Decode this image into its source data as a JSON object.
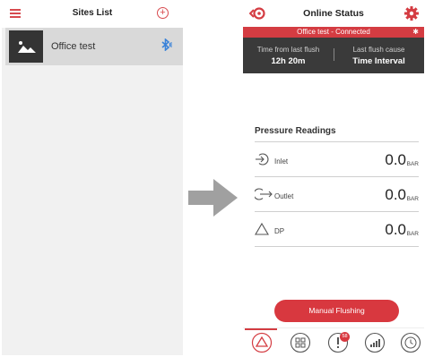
{
  "left": {
    "title": "Sites List",
    "add_symbol": "+",
    "site": {
      "name": "Office test",
      "bluetooth_symbol": "✱"
    }
  },
  "right": {
    "title": "Online Status",
    "status_text": "Office test - Connected",
    "status_bt": "✱",
    "flush_info": {
      "time_label": "Time from last flush",
      "time_value": "12h 20m",
      "cause_label": "Last flush cause",
      "cause_value": "Time Interval"
    },
    "pressure_title": "Pressure Readings",
    "readings": [
      {
        "label": "Inlet",
        "value": "0.0",
        "unit": "BAR",
        "icon": "inlet-icon"
      },
      {
        "label": "Outlet",
        "value": "0.0",
        "unit": "BAR",
        "icon": "outlet-icon"
      },
      {
        "label": "DP",
        "value": "0.0",
        "unit": "BAR",
        "icon": "delta-icon"
      }
    ],
    "manual_flush_label": "Manual Flushing",
    "nav": {
      "items": [
        "status-icon",
        "dashboard-icon",
        "alerts-icon",
        "signal-icon",
        "history-icon"
      ],
      "badge": "58"
    }
  },
  "colors": {
    "accent": "#d43c42",
    "dark": "#3a3a3a",
    "bluetooth": "#3b83d9"
  }
}
